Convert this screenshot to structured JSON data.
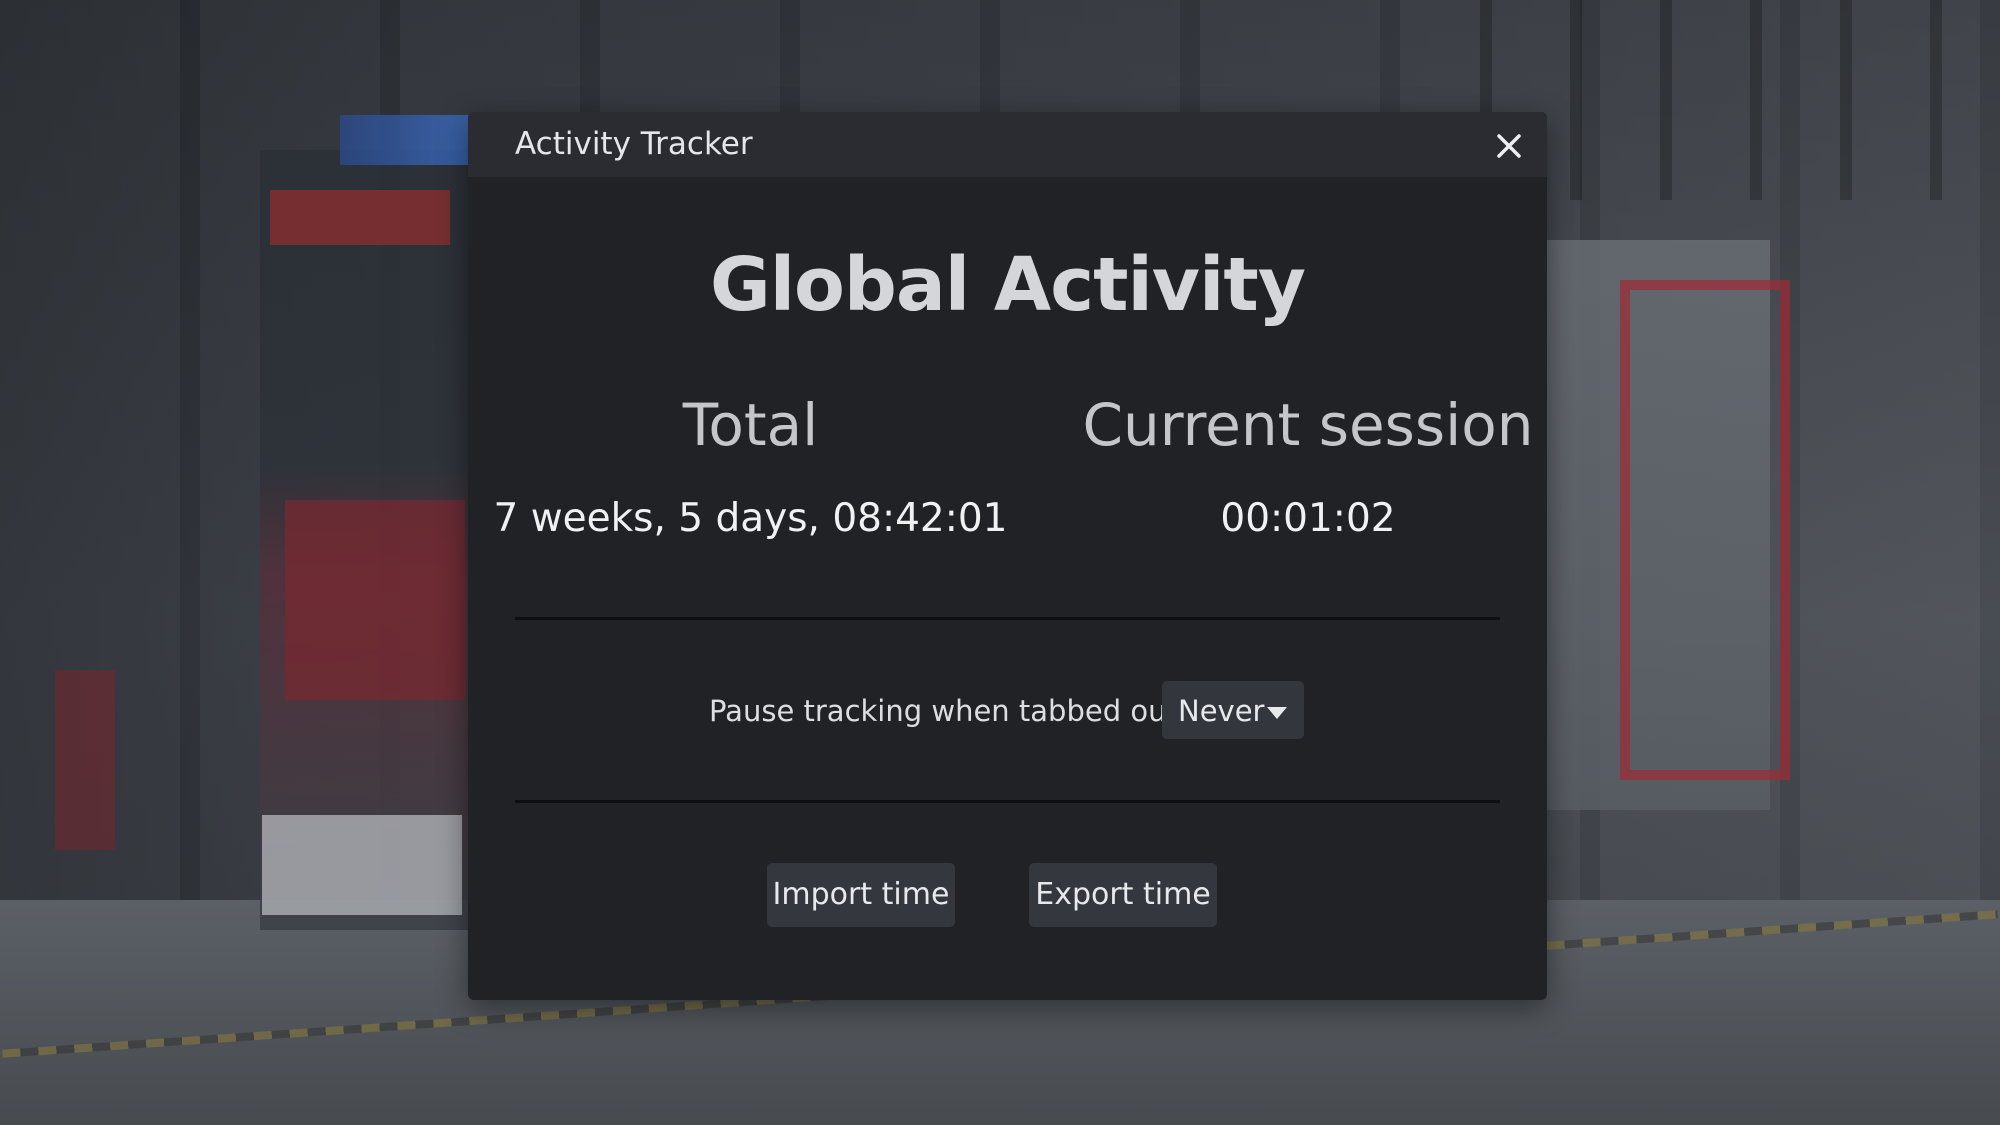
{
  "dialog": {
    "title": "Activity Tracker",
    "close_icon": "close-icon",
    "heading": "Global Activity"
  },
  "stats": {
    "total_label": "Total",
    "session_label": "Current session",
    "total_value": "7 weeks, 5 days, 08:42:01",
    "session_value": "00:01:02"
  },
  "pause": {
    "label": "Pause tracking when tabbed out:",
    "selected": "Never",
    "caret_icon": "caret-down-icon"
  },
  "actions": {
    "import_label": "Import time",
    "export_label": "Export time"
  },
  "colors": {
    "dialog_bg": "#202226",
    "title_bar_bg": "#2a2c31",
    "button_bg": "#34373d",
    "text": "#e8e9ec"
  }
}
